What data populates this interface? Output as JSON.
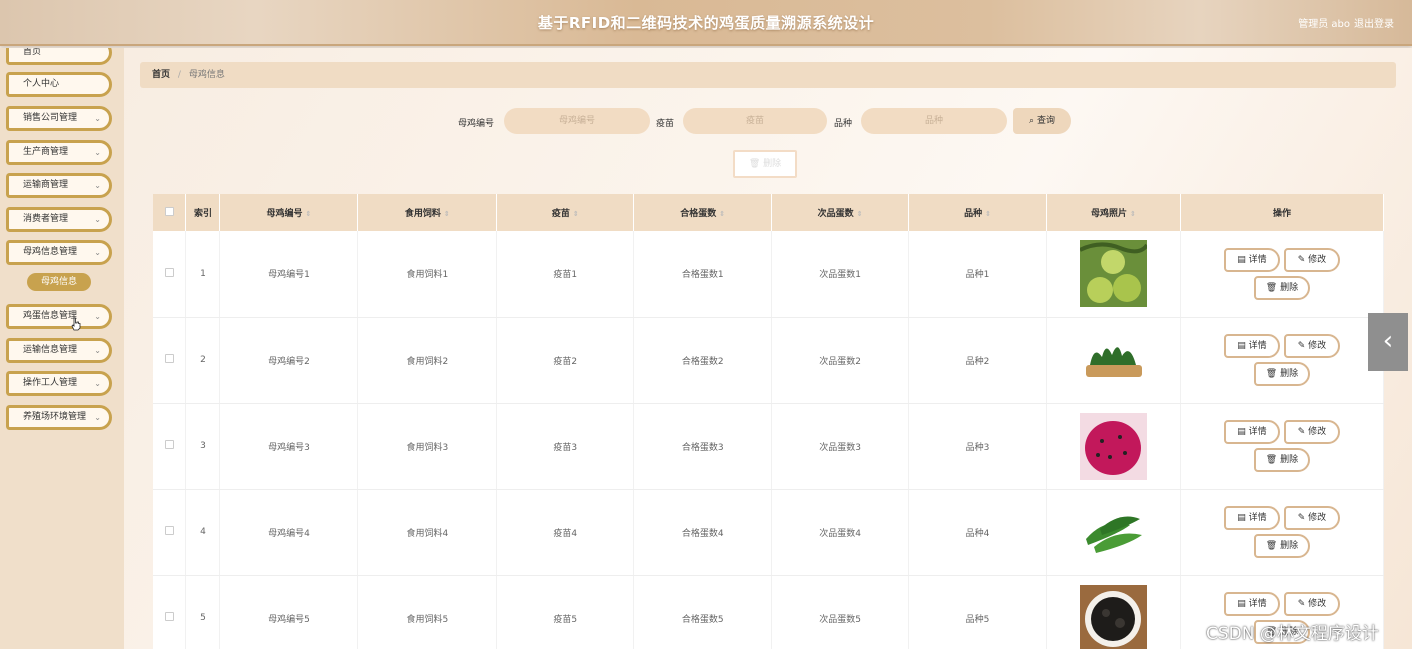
{
  "header": {
    "title": "基于RFID和二维码技术的鸡蛋质量溯源系统设计",
    "user": "管理员 abo",
    "logout": "退出登录"
  },
  "sidebar": {
    "items": [
      {
        "label": "首页",
        "top": 0
      },
      {
        "label": "个人中心"
      },
      {
        "label": "销售公司管理"
      },
      {
        "label": "生产商管理"
      },
      {
        "label": "运输商管理"
      },
      {
        "label": "消费者管理"
      },
      {
        "label": "母鸡信息管理"
      },
      {
        "label": "鸡蛋信息管理"
      },
      {
        "label": "运输信息管理"
      },
      {
        "label": "操作工人管理"
      },
      {
        "label": "养殖场环境管理"
      }
    ],
    "sub_item": "母鸡信息"
  },
  "breadcrumb": {
    "home": "首页",
    "current": "母鸡信息"
  },
  "search": {
    "hen_label": "母鸡编号",
    "hen_placeholder": "母鸡编号",
    "vaccine_label": "疫苗",
    "vaccine_placeholder": "疫苗",
    "breed_label": "品种",
    "breed_placeholder": "品种",
    "query": "查询",
    "delete": "删除"
  },
  "table": {
    "headers": [
      "索引",
      "母鸡编号",
      "食用饲料",
      "疫苗",
      "合格蛋数",
      "次品蛋数",
      "品种",
      "母鸡照片",
      "操作"
    ],
    "rows": [
      [
        "1",
        "母鸡编号1",
        "食用饲料1",
        "疫苗1",
        "合格蛋数1",
        "次品蛋数1",
        "品种1"
      ],
      [
        "2",
        "母鸡编号2",
        "食用饲料2",
        "疫苗2",
        "合格蛋数2",
        "次品蛋数2",
        "品种2"
      ],
      [
        "3",
        "母鸡编号3",
        "食用饲料3",
        "疫苗3",
        "合格蛋数3",
        "次品蛋数3",
        "品种3"
      ],
      [
        "4",
        "母鸡编号4",
        "食用饲料4",
        "疫苗4",
        "合格蛋数4",
        "次品蛋数4",
        "品种4"
      ],
      [
        "5",
        "母鸡编号5",
        "食用饲料5",
        "疫苗5",
        "合格蛋数5",
        "次品蛋数5",
        "品种5"
      ]
    ],
    "actions": {
      "detail": "详情",
      "edit": "修改",
      "delete": "删除"
    }
  },
  "watermark": "CSDN @林文程序设计",
  "colors": {
    "accent": "#c8a24e",
    "header_bg": "#d9b995",
    "table_header": "#f0dcc4"
  }
}
